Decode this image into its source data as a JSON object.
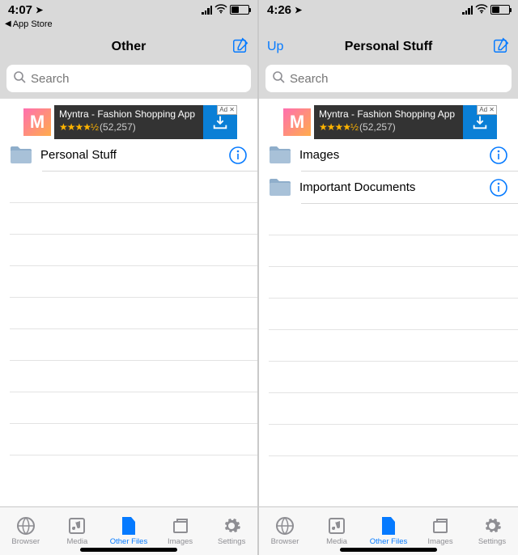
{
  "left": {
    "status": {
      "time": "4:07",
      "back_app": "App Store"
    },
    "nav": {
      "back": "",
      "title": "Other"
    },
    "search_placeholder": "Search",
    "ad": {
      "title": "Myntra - Fashion Shopping App",
      "stars": "★★★★½",
      "count": "(52,257)",
      "tag": "Ad ✕",
      "logo": "M"
    },
    "folders": [
      {
        "name": "Personal Stuff"
      }
    ],
    "tabs": [
      {
        "id": "browser",
        "label": "Browser"
      },
      {
        "id": "media",
        "label": "Media"
      },
      {
        "id": "other",
        "label": "Other Files"
      },
      {
        "id": "images",
        "label": "Images"
      },
      {
        "id": "settings",
        "label": "Settings"
      }
    ]
  },
  "right": {
    "status": {
      "time": "4:26",
      "back_app": ""
    },
    "nav": {
      "back": "Up",
      "title": "Personal Stuff"
    },
    "search_placeholder": "Search",
    "ad": {
      "title": "Myntra - Fashion Shopping App",
      "stars": "★★★★½",
      "count": "(52,257)",
      "tag": "Ad ✕",
      "logo": "M"
    },
    "folders": [
      {
        "name": "Images"
      },
      {
        "name": "Important Documents"
      }
    ],
    "tabs": [
      {
        "id": "browser",
        "label": "Browser"
      },
      {
        "id": "media",
        "label": "Media"
      },
      {
        "id": "other",
        "label": "Other Files"
      },
      {
        "id": "images",
        "label": "Images"
      },
      {
        "id": "settings",
        "label": "Settings"
      }
    ]
  }
}
